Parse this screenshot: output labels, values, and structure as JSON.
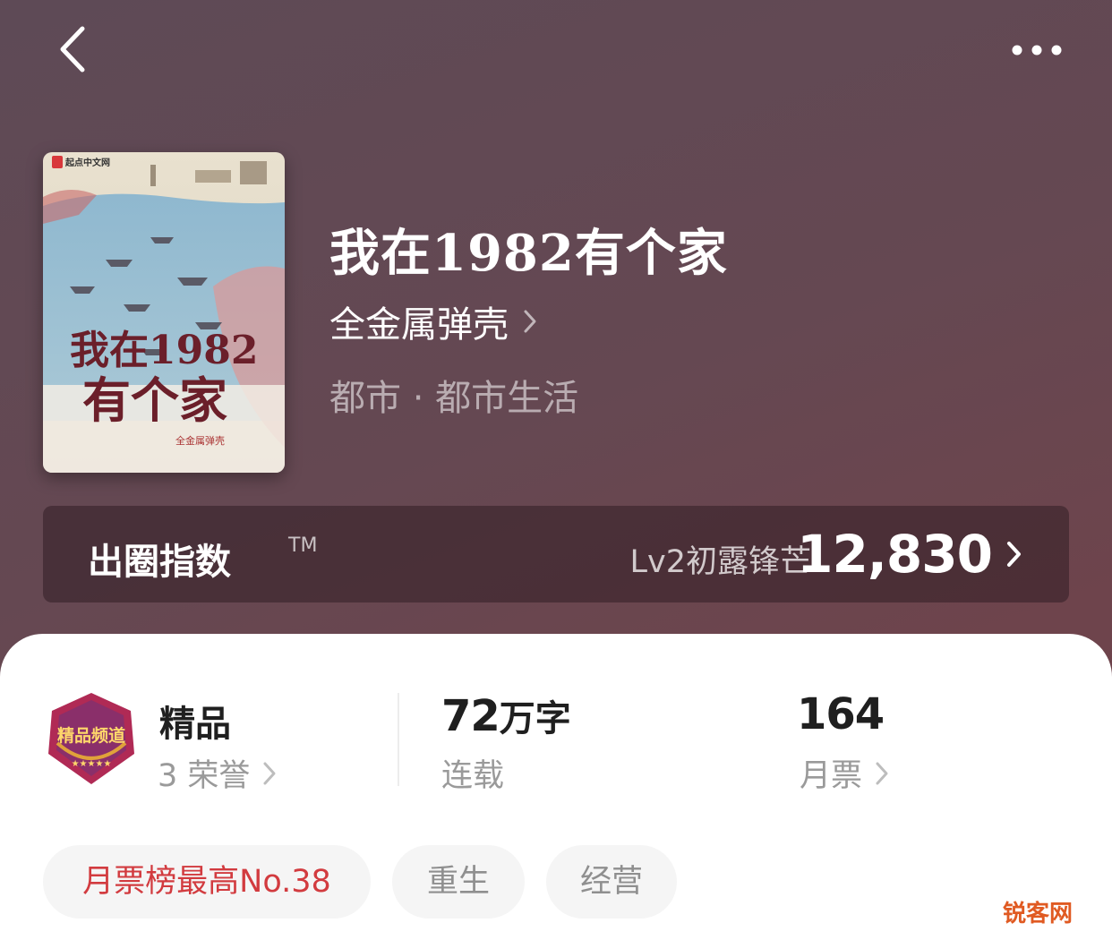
{
  "header": {
    "back_icon": "chevron-left-icon",
    "more_icon": "more-horizontal-icon"
  },
  "book": {
    "title": "我在1982有个家",
    "author": "全金属弹壳",
    "genre": "都市 · 都市生活",
    "cover": {
      "publisher_logo_text": "起点中文网",
      "cover_title_line1": "我在1982",
      "cover_title_line2": "有个家",
      "cover_author": "全金属弹壳"
    }
  },
  "index": {
    "label": "出圈指数",
    "tm": "TM",
    "level": "Lv2初露锋芒",
    "score": "12,830"
  },
  "stats": {
    "quality": {
      "title": "精品",
      "sub": "3 荣誉",
      "badge_text": "精品频道"
    },
    "words": {
      "value": "72",
      "unit": "万字",
      "sub": "连载"
    },
    "tickets": {
      "value": "164",
      "sub": "月票"
    }
  },
  "tags": [
    {
      "label": "月票榜最高No.38"
    },
    {
      "label": "重生"
    },
    {
      "label": "经营"
    }
  ],
  "watermark": "锐客网",
  "colors": {
    "background": "#654852",
    "accent_red": "#d23b3f",
    "badge_purple": "#8a2f6a"
  }
}
